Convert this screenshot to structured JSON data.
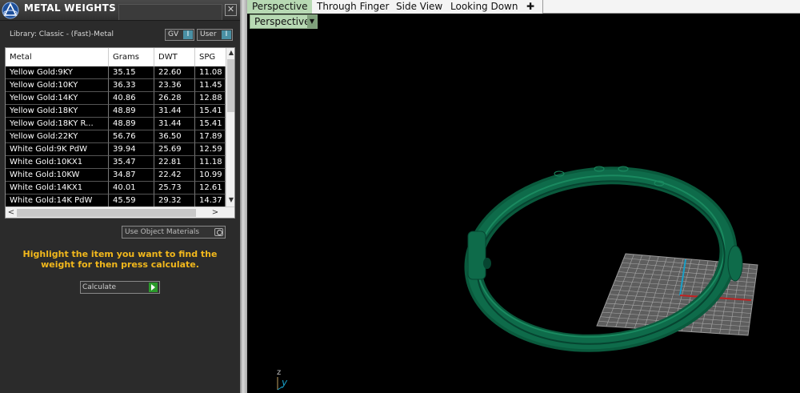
{
  "panel": {
    "title": "METAL WEIGHTS",
    "close_glyph": "☒",
    "library_label": "Library: Classic - (Fast)-Metal",
    "toggles": [
      {
        "label": "GV",
        "knob": "I"
      },
      {
        "label": "User",
        "knob": "I"
      }
    ],
    "table": {
      "headers": [
        "Metal",
        "Grams",
        "DWT",
        "SPG"
      ],
      "rows": [
        [
          "Yellow Gold:9KY",
          "35.15",
          "22.60",
          "11.08"
        ],
        [
          "Yellow Gold:10KY",
          "36.33",
          "23.36",
          "11.45"
        ],
        [
          "Yellow Gold:14KY",
          "40.86",
          "26.28",
          "12.88"
        ],
        [
          "Yellow Gold:18KY",
          "48.89",
          "31.44",
          "15.41"
        ],
        [
          "Yellow Gold:18KY R...",
          "48.89",
          "31.44",
          "15.41"
        ],
        [
          "Yellow Gold:22KY",
          "56.76",
          "36.50",
          "17.89"
        ],
        [
          "White Gold:9K PdW",
          "39.94",
          "25.69",
          "12.59"
        ],
        [
          "White Gold:10KX1",
          "35.47",
          "22.81",
          "11.18"
        ],
        [
          "White Gold:10KW",
          "34.87",
          "22.42",
          "10.99"
        ],
        [
          "White Gold:14KX1",
          "40.01",
          "25.73",
          "12.61"
        ],
        [
          "White Gold:14K PdW",
          "45.59",
          "29.32",
          "14.37"
        ]
      ],
      "scroll_up": "▲",
      "scroll_down": "▼",
      "scroll_left": "<",
      "scroll_right": ">"
    },
    "use_object_materials": "Use Object Materials",
    "instruction": "Highlight the item you want to find the weight for then press calculate.",
    "calculate_label": "Calculate"
  },
  "viewport": {
    "tabs": [
      "Perspective",
      "Through Finger",
      "Side View",
      "Looking Down",
      "✚"
    ],
    "active_tab": "Perspective",
    "view_dropdown": "Perspective",
    "axis_z": "z",
    "axis_y": "y",
    "ring_color": "#0e6b4a"
  }
}
